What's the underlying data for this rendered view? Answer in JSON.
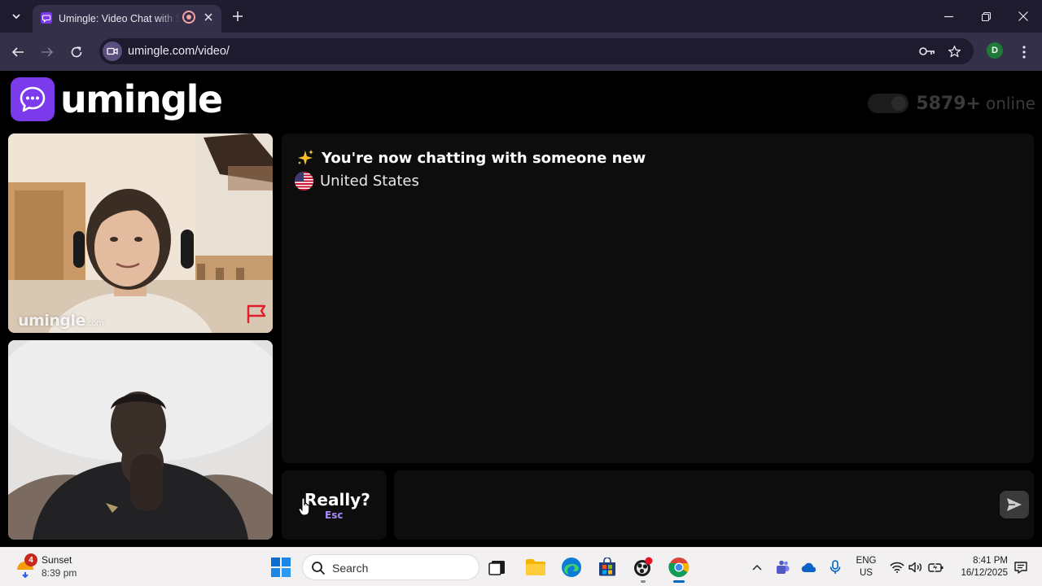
{
  "browser": {
    "tab_title": "Umingle: Video Chat with Strangers",
    "url": "umingle.com/video/",
    "profile_initial": "D"
  },
  "header": {
    "logo_text": "umingle",
    "online_count": "5879+",
    "online_label": "online"
  },
  "videos": {
    "watermark_main": "umingle",
    "watermark_suffix": ".com"
  },
  "chat": {
    "system_message": "You're now chatting with someone new",
    "country": "United States"
  },
  "controls": {
    "esc_label": "Really?",
    "esc_hint": "Esc",
    "message_placeholder": ""
  },
  "taskbar": {
    "weather_badge": "4",
    "weather_title": "Sunset",
    "weather_time": "8:39 pm",
    "search_placeholder": "Search",
    "lang_line1": "ENG",
    "lang_line2": "US",
    "time": "8:41 PM",
    "date": "16/12/2025"
  },
  "colors": {
    "brand_purple": "#7c3aed",
    "esc_hint": "#a78bfa",
    "browser_dark": "#1f1b2e",
    "browser_toolbar": "#34304a"
  }
}
